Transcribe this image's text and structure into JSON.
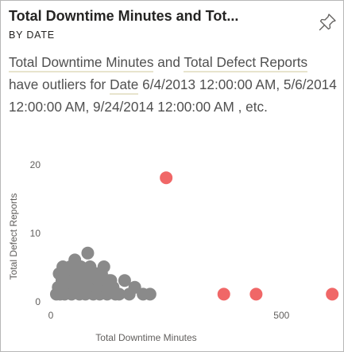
{
  "card": {
    "title": "Total Downtime Minutes and Tot...",
    "subtitle": "BY DATE",
    "pin_icon": "pin-icon"
  },
  "insight": {
    "measure1": "Total Downtime Minutes",
    "and": " and ",
    "measure2": "Total Defect Reports",
    "mid": " have outliers for ",
    "field": "Date",
    "tail": " 6/4/2013 12:00:00 AM, 5/6/2014 12:00:00 AM, 9/24/2014 12:00:00 AM , etc."
  },
  "colors": {
    "normal": "#8a8a8a",
    "outlier": "#f06767"
  },
  "chart_data": {
    "type": "scatter",
    "xlabel": "Total Downtime Minutes",
    "ylabel": "Total Defect Reports",
    "xlim": [
      0,
      620
    ],
    "ylim": [
      0,
      20
    ],
    "xticks": [
      0,
      500
    ],
    "yticks": [
      0,
      10,
      20
    ],
    "series": [
      {
        "role": "normal",
        "points": [
          [
            12,
            1
          ],
          [
            16,
            2
          ],
          [
            18,
            4
          ],
          [
            20,
            1
          ],
          [
            24,
            3
          ],
          [
            26,
            5
          ],
          [
            30,
            1
          ],
          [
            35,
            2
          ],
          [
            38,
            4
          ],
          [
            42,
            5
          ],
          [
            45,
            1
          ],
          [
            48,
            3
          ],
          [
            52,
            6
          ],
          [
            55,
            2
          ],
          [
            60,
            4
          ],
          [
            62,
            1
          ],
          [
            65,
            5
          ],
          [
            68,
            3
          ],
          [
            72,
            2
          ],
          [
            75,
            1
          ],
          [
            78,
            4
          ],
          [
            82,
            2
          ],
          [
            85,
            5
          ],
          [
            88,
            3
          ],
          [
            92,
            1
          ],
          [
            95,
            4
          ],
          [
            98,
            2
          ],
          [
            102,
            3
          ],
          [
            106,
            1
          ],
          [
            110,
            4
          ],
          [
            115,
            5
          ],
          [
            118,
            2
          ],
          [
            122,
            1
          ],
          [
            126,
            3
          ],
          [
            130,
            3
          ],
          [
            135,
            2
          ],
          [
            140,
            1
          ],
          [
            148,
            1
          ],
          [
            160,
            3
          ],
          [
            170,
            1
          ],
          [
            182,
            2
          ],
          [
            200,
            1
          ],
          [
            215,
            1
          ],
          [
            80,
            7
          ],
          [
            100,
            4
          ],
          [
            120,
            3
          ]
        ]
      },
      {
        "role": "outlier",
        "points": [
          [
            250,
            18
          ],
          [
            375,
            1
          ],
          [
            445,
            1
          ],
          [
            610,
            1
          ]
        ]
      }
    ]
  }
}
